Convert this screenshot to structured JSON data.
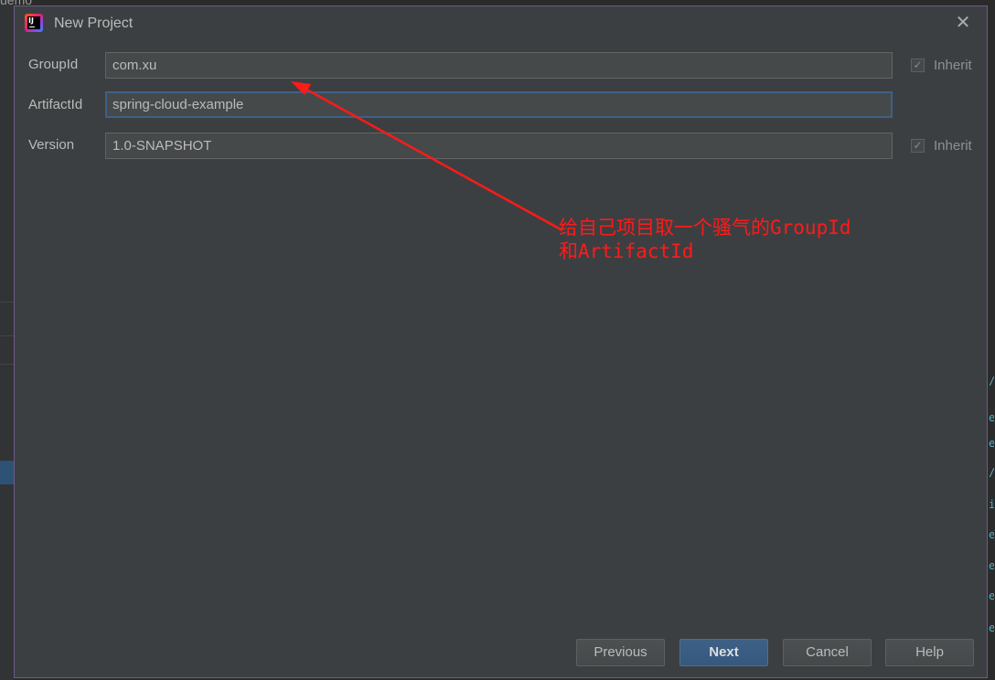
{
  "background": {
    "top_text": "uemo"
  },
  "dialog": {
    "title": "New Project",
    "close_glyph": "✕",
    "app_icon_text": "IJ",
    "fields": [
      {
        "label": "GroupId",
        "value": "com.xu",
        "inherit": true,
        "inherit_label": "Inherit"
      },
      {
        "label": "ArtifactId",
        "value": "spring-cloud-example",
        "inherit": false
      },
      {
        "label": "Version",
        "value": "1.0-SNAPSHOT",
        "inherit": true,
        "inherit_label": "Inherit"
      }
    ],
    "buttons": {
      "previous": "Previous",
      "next": "Next",
      "cancel": "Cancel",
      "help": "Help"
    }
  },
  "annotation": {
    "line1": "给自己项目取一个骚气的GroupId",
    "line2": "和ArtifactId",
    "color": "#ff1a1a"
  },
  "colors": {
    "dialog_bg": "#3c3f41",
    "field_bg": "#45494a",
    "focus_border": "#3d6185",
    "primary_button": "#365880"
  }
}
